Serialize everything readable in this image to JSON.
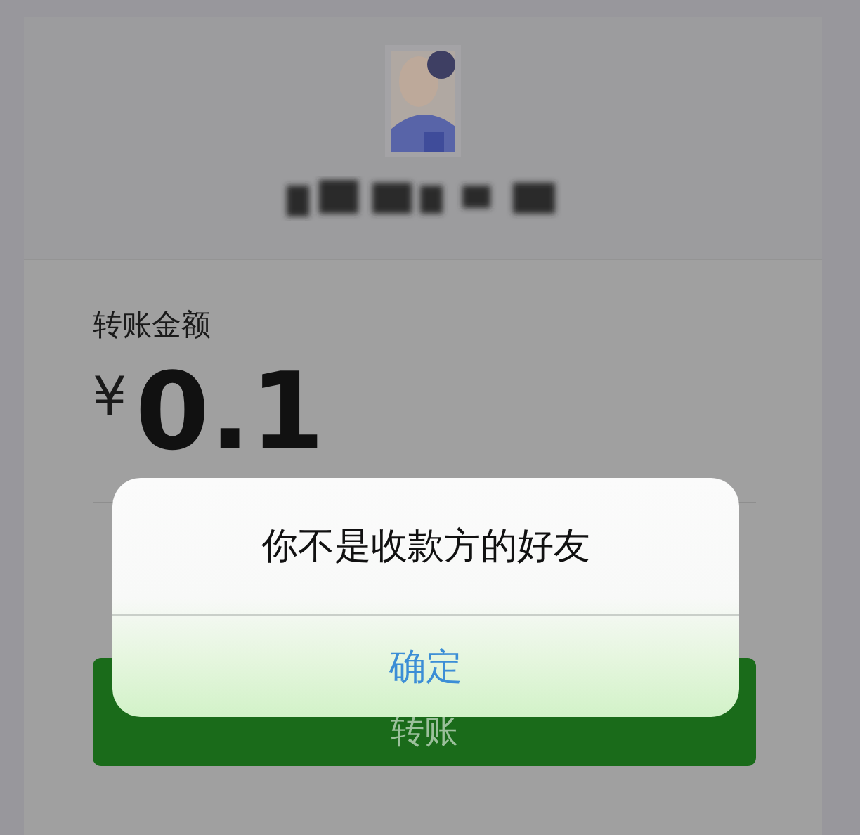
{
  "transfer": {
    "amount_label": "转账金额",
    "currency": "¥",
    "amount": "0.1",
    "submit_button": "转账"
  },
  "alert": {
    "message": "你不是收款方的好友",
    "confirm_button": "确定"
  }
}
